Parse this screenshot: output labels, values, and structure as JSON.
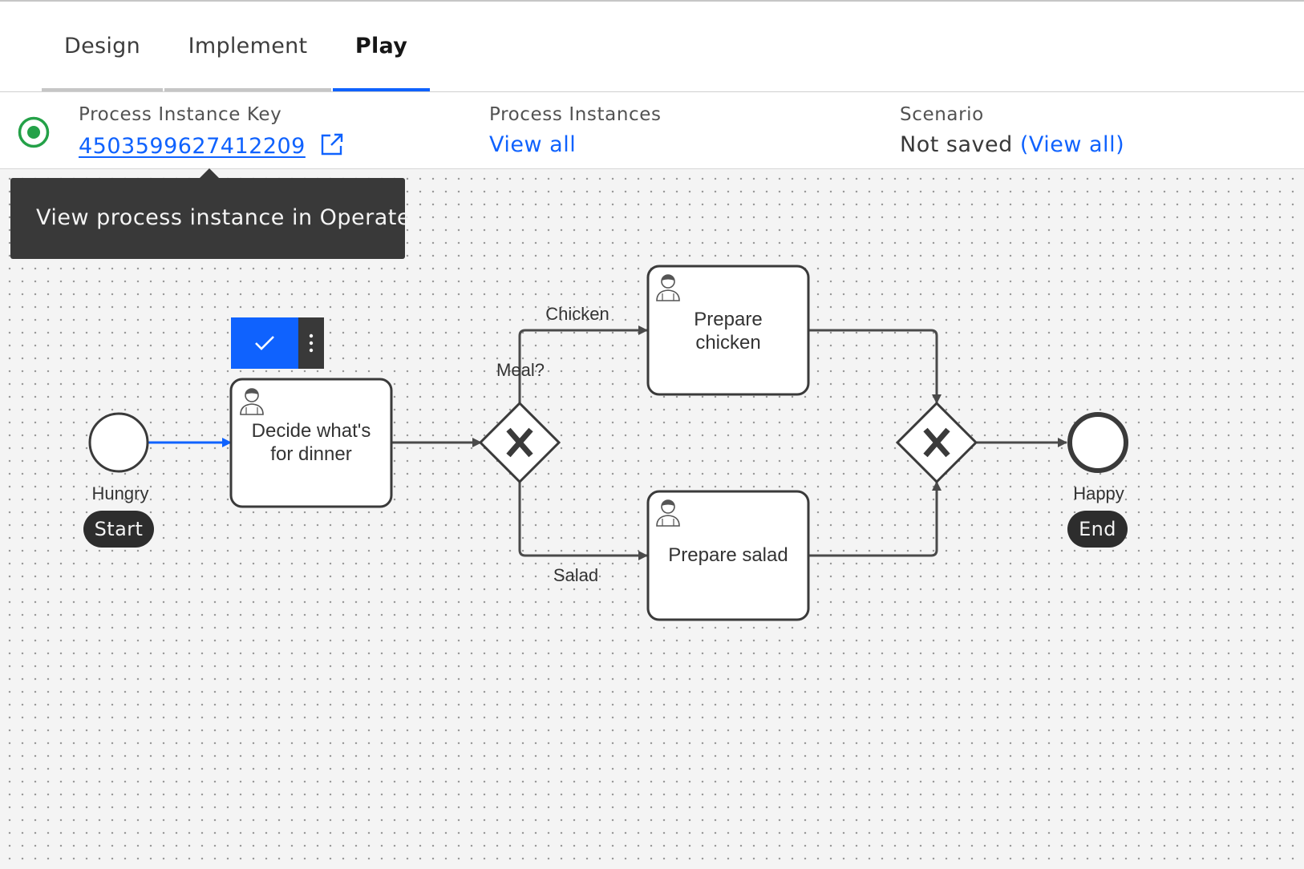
{
  "tabs": [
    {
      "label": "Design",
      "active": false
    },
    {
      "label": "Implement",
      "active": false
    },
    {
      "label": "Play",
      "active": true
    }
  ],
  "info": {
    "status_icon": "radio-button-checked-icon",
    "process_instance_key": {
      "label": "Process Instance Key",
      "value": "4503599627412209",
      "icon": "launch-icon"
    },
    "process_instances": {
      "label": "Process Instances",
      "link": "View all"
    },
    "scenario": {
      "label": "Scenario",
      "value": "Not saved",
      "link": "(View all)"
    }
  },
  "tooltip": {
    "text": "View process instance in Operate"
  },
  "toolbar": {
    "complete_icon": "checkmark-icon",
    "more_icon": "overflow-menu-vertical-icon"
  },
  "diagram": {
    "start_event": {
      "label": "Hungry",
      "badge": "Start"
    },
    "task_decide": {
      "line1": "Decide what's",
      "line2": "for dinner",
      "icon": "user-icon"
    },
    "gateway_split": {
      "label": "Meal?",
      "marker": "X"
    },
    "gateway_join": {
      "marker": "X"
    },
    "flow_chicken": {
      "label": "Chicken"
    },
    "flow_salad": {
      "label": "Salad"
    },
    "task_chicken": {
      "line1": "Prepare",
      "line2": "chicken",
      "icon": "user-icon"
    },
    "task_salad": {
      "line1": "Prepare salad",
      "icon": "user-icon"
    },
    "end_event": {
      "label": "Happy",
      "badge": "End"
    }
  },
  "colors": {
    "accent": "#0f62fe",
    "active_flow": "#0f62fe",
    "status_green": "#24a148",
    "tooltip_bg": "#393939",
    "canvas_bg": "#f4f4f4"
  }
}
